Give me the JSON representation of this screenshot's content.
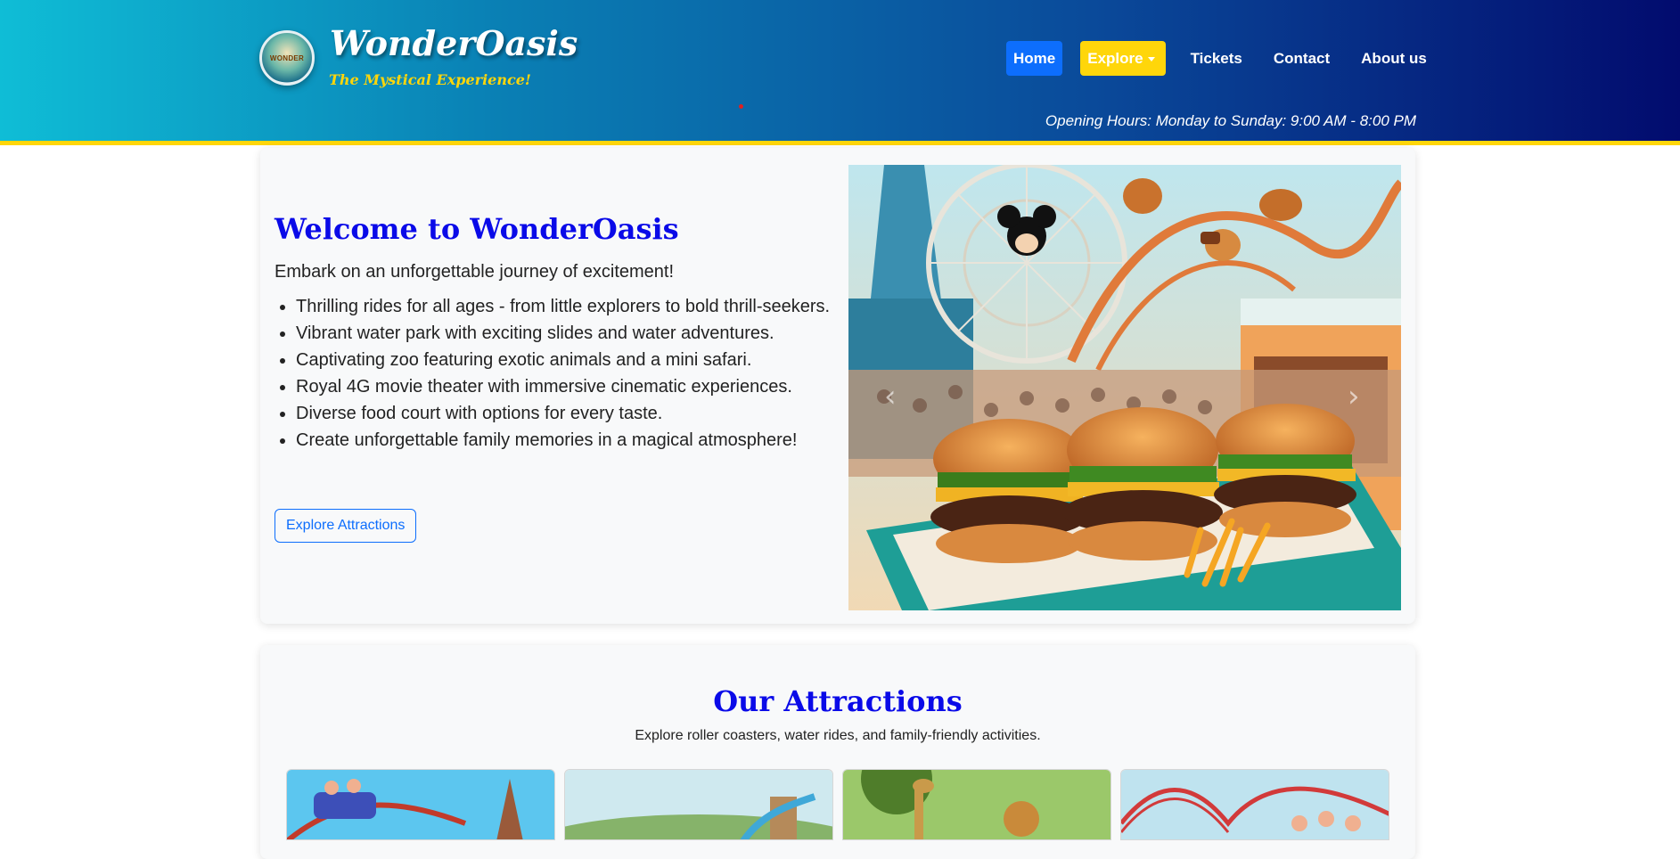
{
  "brand": {
    "name": "WonderOasis",
    "tagline": "The Mystical Experience!",
    "logo_text": "WONDER"
  },
  "nav": {
    "home": "Home",
    "explore": "Explore",
    "tickets": "Tickets",
    "contact": "Contact",
    "about": "About us"
  },
  "hours": "Opening Hours: Monday to Sunday: 9:00 AM - 8:00 PM",
  "welcome": {
    "title": "Welcome to WonderOasis",
    "intro": "Embark on an unforgettable journey of excitement!",
    "features": [
      "Thrilling rides for all ages - from little explorers to bold thrill-seekers.",
      "Vibrant water park with exciting slides and water adventures.",
      "Captivating zoo featuring exotic animals and a mini safari.",
      "Royal 4G movie theater with immersive cinematic experiences.",
      "Diverse food court with options for every taste.",
      "Create unforgettable family memories in a magical atmosphere!"
    ],
    "button": "Explore Attractions"
  },
  "attractions": {
    "title": "Our Attractions",
    "subtitle": "Explore roller coasters, water rides, and family-friendly activities."
  },
  "colors": {
    "accent_yellow": "#ffd60a",
    "primary_blue": "#0d6efd",
    "title_blue": "#0a0ae8",
    "header_gradient_start": "#0fbdd6",
    "header_gradient_end": "#020b6e"
  }
}
